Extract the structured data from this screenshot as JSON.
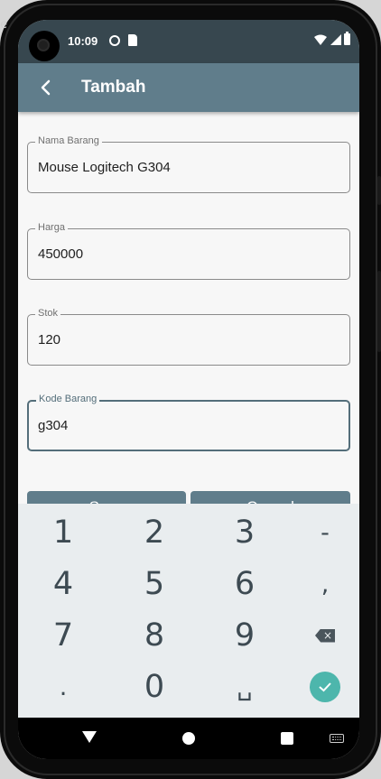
{
  "status_bar": {
    "time": "10:09"
  },
  "app_bar": {
    "title": "Tambah"
  },
  "form": {
    "fields": [
      {
        "label": "Nama Barang",
        "value": "Mouse Logitech G304"
      },
      {
        "label": "Harga",
        "value": "450000"
      },
      {
        "label": "Stok",
        "value": "120"
      },
      {
        "label": "Kode Barang",
        "value": "g304"
      }
    ],
    "save_label": "Save",
    "cancel_label": "Cancel"
  },
  "keyboard": {
    "rows": [
      [
        "1",
        "2",
        "3",
        "-"
      ],
      [
        "4",
        "5",
        "6",
        ","
      ],
      [
        "7",
        "8",
        "9",
        "backspace-icon"
      ],
      [
        ".",
        "0",
        "␣",
        "done-icon"
      ]
    ],
    "accent_color": "#4db6ac"
  },
  "colors": {
    "app_bar": "#607d8b",
    "status_bar": "#37474f",
    "focus": "#546e7a"
  }
}
